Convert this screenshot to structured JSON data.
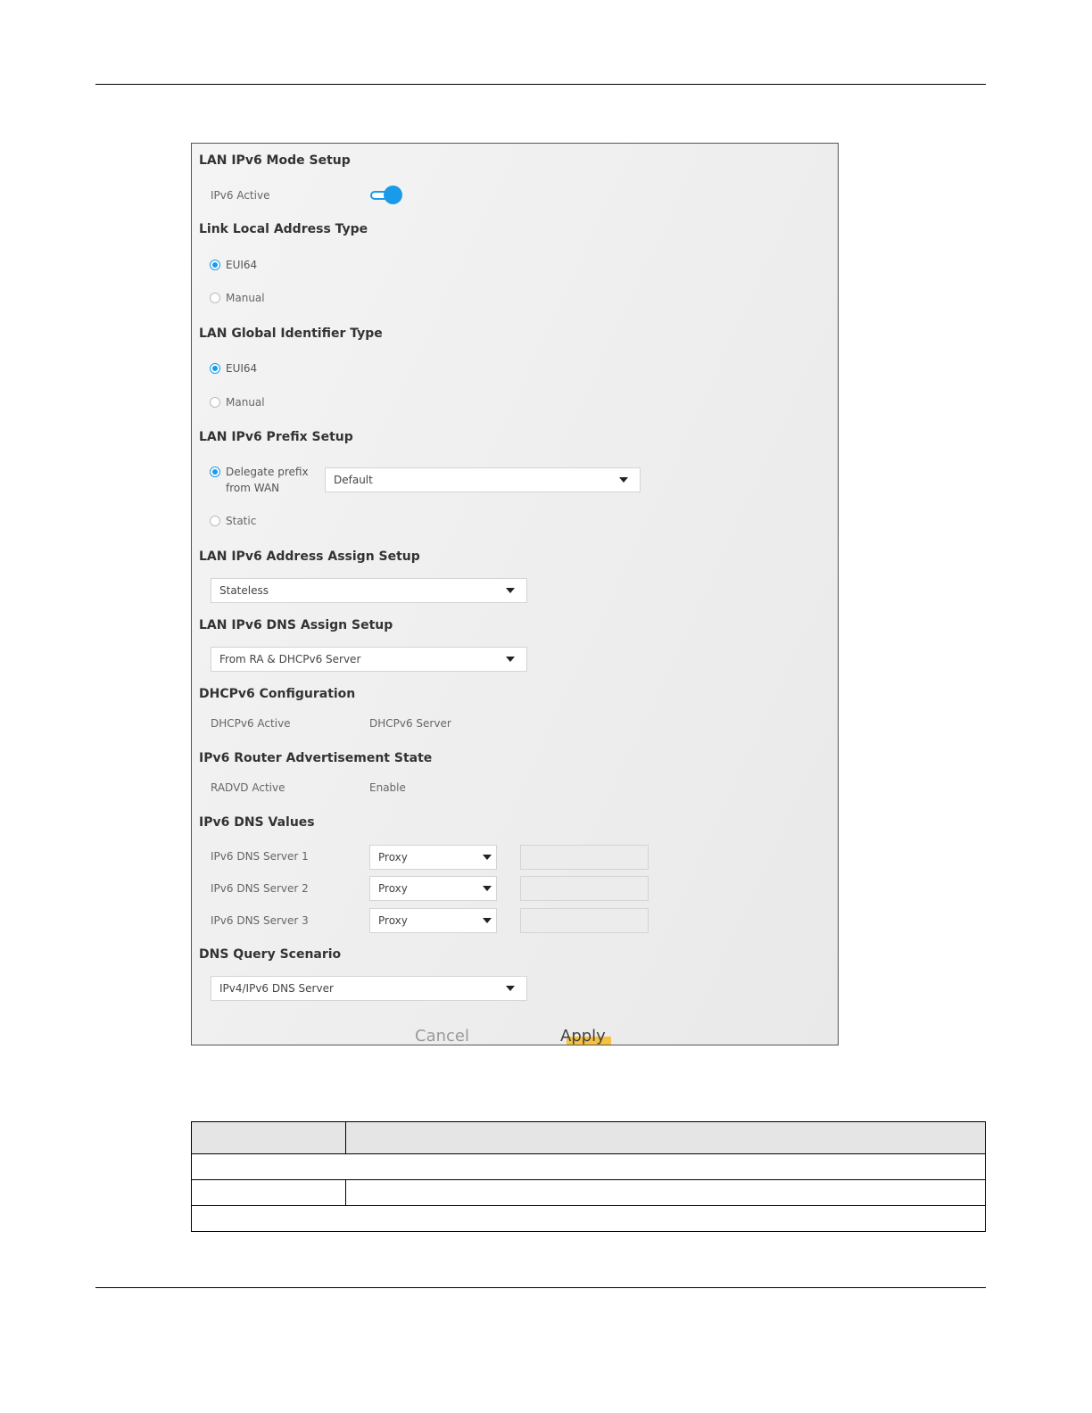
{
  "sections": {
    "mode_setup": "LAN IPv6 Mode Setup",
    "link_local": "Link Local Address Type",
    "global_id": "LAN Global Identifier Type",
    "prefix_setup": "LAN IPv6 Prefix Setup",
    "address_assign": "LAN IPv6 Address Assign Setup",
    "dns_assign": "LAN IPv6 DNS Assign Setup",
    "dhcpv6_config": "DHCPv6 Configuration",
    "router_adv": "IPv6 Router Advertisement State",
    "dns_values": "IPv6 DNS Values",
    "dns_query": "DNS Query Scenario"
  },
  "mode_setup": {
    "ipv6_active_label": "IPv6 Active",
    "ipv6_active_on": true
  },
  "link_local": {
    "eui64": "EUI64",
    "manual": "Manual",
    "selected": "eui64"
  },
  "global_id": {
    "eui64": "EUI64",
    "manual": "Manual",
    "selected": "eui64"
  },
  "prefix_setup": {
    "delegate_line1": "Delegate prefix",
    "delegate_line2": "from WAN",
    "delegate_select": "Default",
    "static": "Static",
    "selected": "delegate"
  },
  "address_assign": {
    "value": "Stateless"
  },
  "dns_assign": {
    "value": "From RA & DHCPv6 Server"
  },
  "dhcpv6_config": {
    "label": "DHCPv6 Active",
    "value": "DHCPv6 Server"
  },
  "router_adv": {
    "label": "RADVD Active",
    "value": "Enable"
  },
  "dns_values": {
    "servers": [
      {
        "label": "IPv6 DNS Server 1",
        "mode": "Proxy",
        "address": ""
      },
      {
        "label": "IPv6 DNS Server 2",
        "mode": "Proxy",
        "address": ""
      },
      {
        "label": "IPv6 DNS Server 3",
        "mode": "Proxy",
        "address": ""
      }
    ]
  },
  "dns_query": {
    "value": "IPv4/IPv6 DNS Server"
  },
  "buttons": {
    "cancel": "Cancel",
    "apply": "Apply"
  },
  "colors": {
    "accent": "#1a9bea",
    "apply_highlight": "#f6c23e"
  }
}
